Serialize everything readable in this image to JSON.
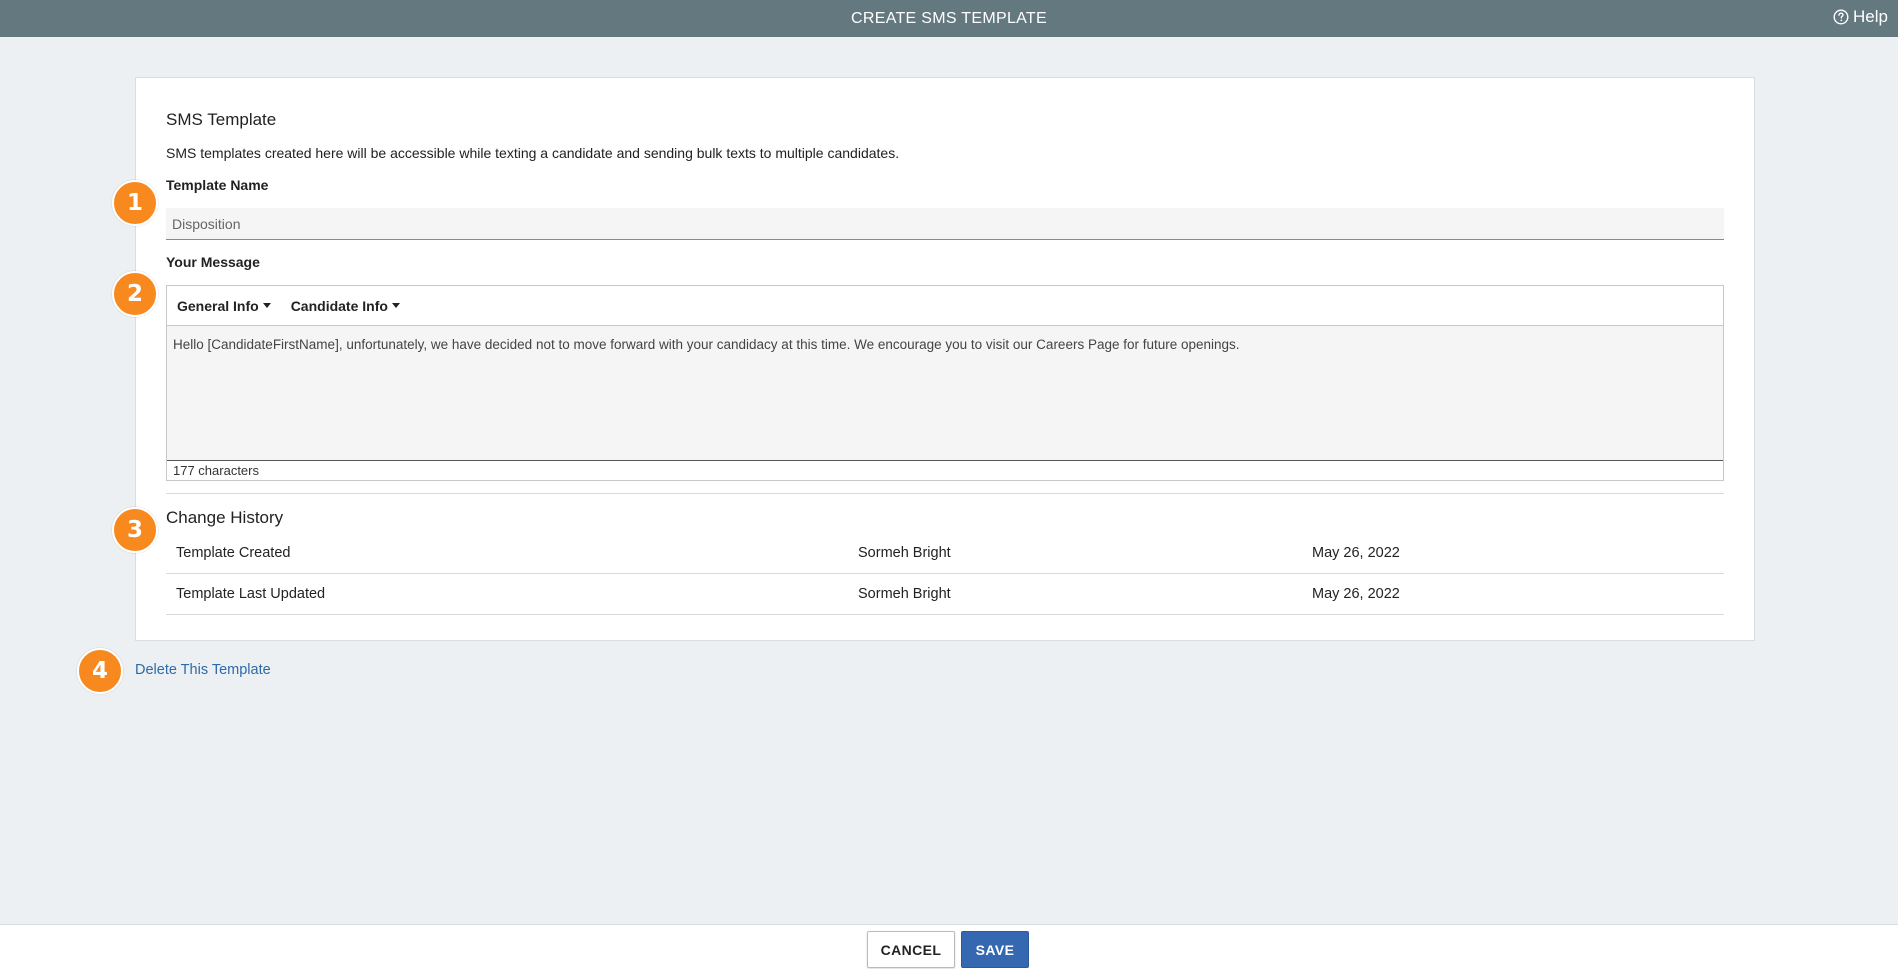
{
  "header": {
    "title": "CREATE SMS TEMPLATE",
    "help_label": "Help"
  },
  "template": {
    "section_title": "SMS Template",
    "description": "SMS templates created here will be accessible while texting a candidate and sending bulk texts to multiple candidates.",
    "name_label": "Template Name",
    "name_value": "Disposition",
    "message_label": "Your Message",
    "toolbar": {
      "general_info": "General Info",
      "candidate_info": "Candidate Info"
    },
    "message_value": "Hello [CandidateFirstName], unfortunately, we have decided not to move forward with your candidacy at this time. We encourage you to visit our Careers Page for future openings.",
    "char_count": "177 characters"
  },
  "history": {
    "title": "Change History",
    "rows": [
      {
        "action": "Template Created",
        "user": "Sormeh Bright",
        "date": "May 26, 2022"
      },
      {
        "action": "Template Last Updated",
        "user": "Sormeh Bright",
        "date": "May 26, 2022"
      }
    ]
  },
  "badges": [
    "1",
    "2",
    "3",
    "4"
  ],
  "delete_label": "Delete This Template",
  "footer": {
    "cancel_label": "CANCEL",
    "save_label": "SAVE"
  },
  "colors": {
    "header_bg": "#647880",
    "badge": "#f7891f",
    "save_button": "#3568b1",
    "link": "#2d6aa8"
  }
}
